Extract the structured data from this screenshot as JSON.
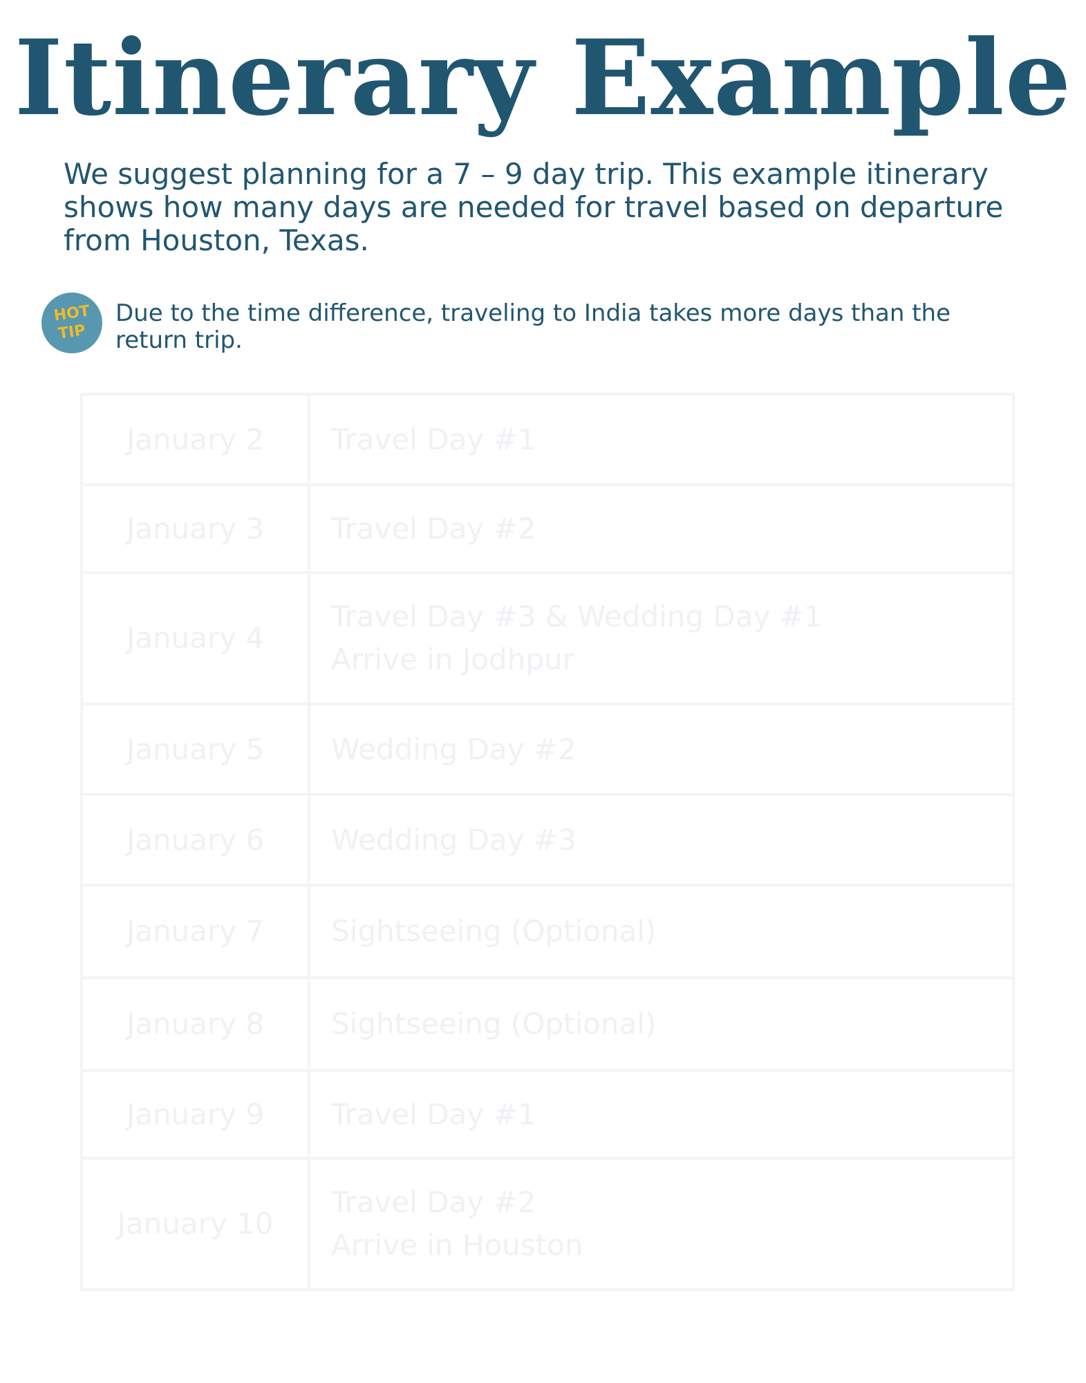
{
  "title": "Itinerary Example",
  "intro": "We suggest planning for a 7 – 9 day trip. This example itinerary shows how many days are needed for travel based on departure from Houston, Texas.",
  "tip": {
    "badge_line1": "HOT",
    "badge_line2": "TIP",
    "text": "Due to the time difference, traveling to India takes more days than the return trip."
  },
  "itinerary": [
    {
      "date": "January 2",
      "lines": [
        "Travel Day #1"
      ]
    },
    {
      "date": "January 3",
      "lines": [
        "Travel Day #2"
      ]
    },
    {
      "date": "January 4",
      "lines": [
        "Travel Day #3 & Wedding Day #1",
        "Arrive in Jodhpur"
      ]
    },
    {
      "date": "January 5",
      "lines": [
        "Wedding Day #2"
      ]
    },
    {
      "date": "January 6",
      "lines": [
        "Wedding Day #3"
      ]
    },
    {
      "date": "January 7",
      "lines": [
        "Sightseeing (Optional)"
      ]
    },
    {
      "date": "January 8",
      "lines": [
        "Sightseeing (Optional)"
      ]
    },
    {
      "date": "January 9",
      "lines": [
        "Travel Day #1"
      ]
    },
    {
      "date": "January 10",
      "lines": [
        "Travel Day #2",
        "Arrive in Houston"
      ]
    }
  ],
  "colors": {
    "heading": "#215671",
    "badge_bg": "#5797af",
    "badge_text": "#f0bb28",
    "table_text": "#f1f0f4",
    "table_border": "#f4f3f6"
  }
}
